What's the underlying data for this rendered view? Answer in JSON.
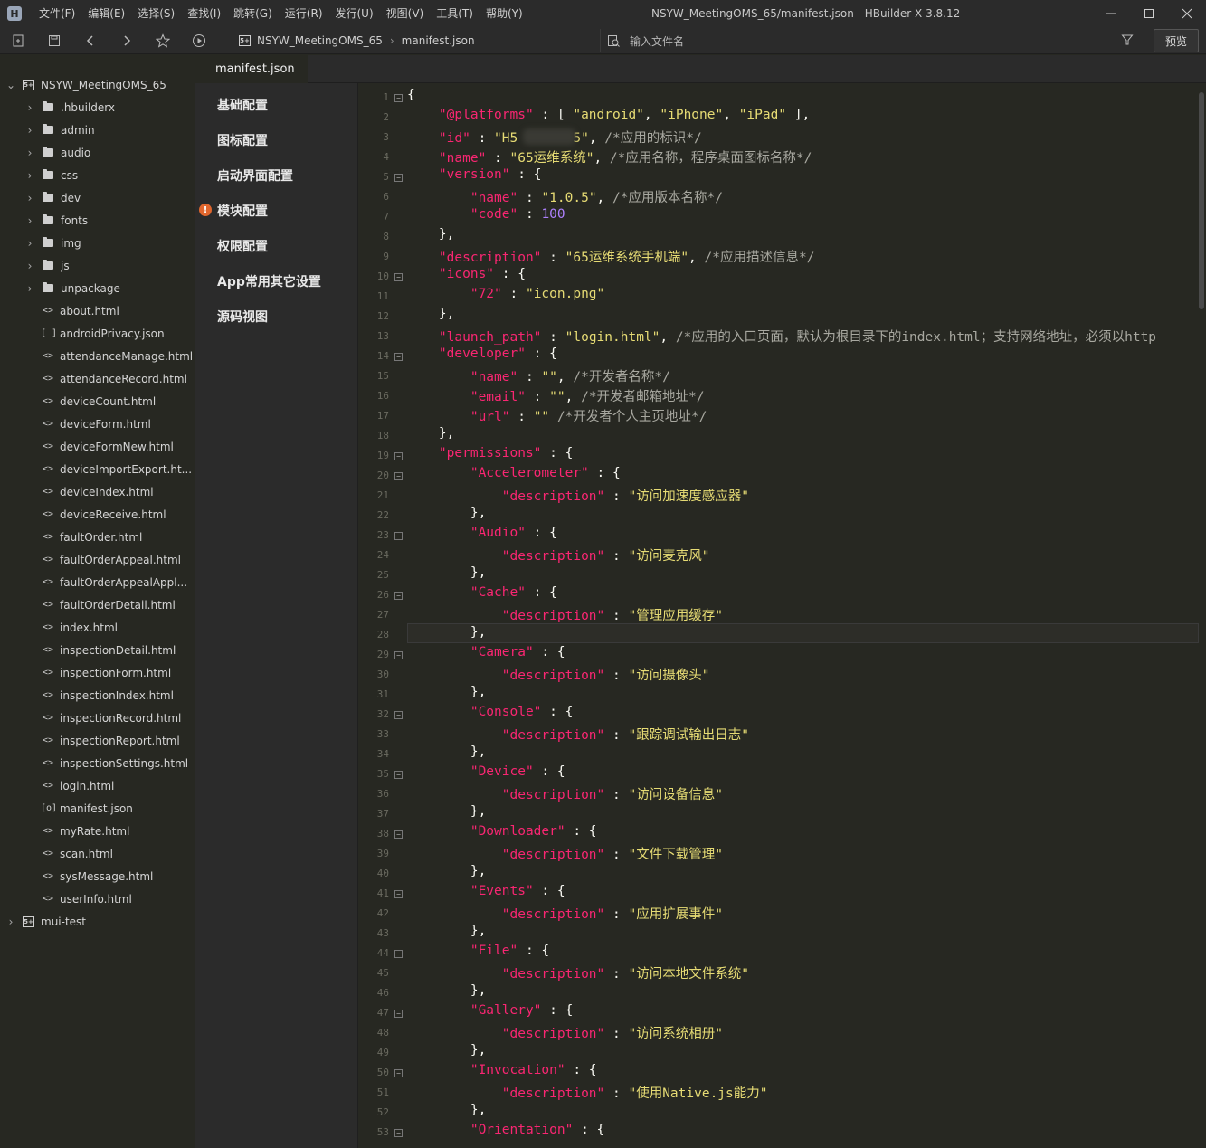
{
  "window": {
    "title": "NSYW_MeetingOMS_65/manifest.json - HBuilder X 3.8.12"
  },
  "menu": [
    "文件(F)",
    "编辑(E)",
    "选择(S)",
    "查找(I)",
    "跳转(G)",
    "运行(R)",
    "发行(U)",
    "视图(V)",
    "工具(T)",
    "帮助(Y)"
  ],
  "toolbar": {
    "breadcrumb": {
      "project": "NSYW_MeetingOMS_65",
      "file": "manifest.json"
    },
    "search_placeholder": "输入文件名",
    "preview_label": "预览"
  },
  "sidebar": {
    "project": "NSYW_MeetingOMS_65",
    "folders": [
      ".hbuilderx",
      "admin",
      "audio",
      "css",
      "dev",
      "fonts",
      "img",
      "js",
      "unpackage"
    ],
    "files": [
      {
        "icon": "<>",
        "name": "about.html"
      },
      {
        "icon": "[ ]",
        "name": "androidPrivacy.json"
      },
      {
        "icon": "<>",
        "name": "attendanceManage.html"
      },
      {
        "icon": "<>",
        "name": "attendanceRecord.html"
      },
      {
        "icon": "<>",
        "name": "deviceCount.html"
      },
      {
        "icon": "<>",
        "name": "deviceForm.html"
      },
      {
        "icon": "<>",
        "name": "deviceFormNew.html"
      },
      {
        "icon": "<>",
        "name": "deviceImportExport.ht..."
      },
      {
        "icon": "<>",
        "name": "deviceIndex.html"
      },
      {
        "icon": "<>",
        "name": "deviceReceive.html"
      },
      {
        "icon": "<>",
        "name": "faultOrder.html"
      },
      {
        "icon": "<>",
        "name": "faultOrderAppeal.html"
      },
      {
        "icon": "<>",
        "name": "faultOrderAppealAppl..."
      },
      {
        "icon": "<>",
        "name": "faultOrderDetail.html"
      },
      {
        "icon": "<>",
        "name": "index.html"
      },
      {
        "icon": "<>",
        "name": "inspectionDetail.html"
      },
      {
        "icon": "<>",
        "name": "inspectionForm.html"
      },
      {
        "icon": "<>",
        "name": "inspectionIndex.html"
      },
      {
        "icon": "<>",
        "name": "inspectionRecord.html"
      },
      {
        "icon": "<>",
        "name": "inspectionReport.html"
      },
      {
        "icon": "<>",
        "name": "inspectionSettings.html"
      },
      {
        "icon": "<>",
        "name": "login.html"
      },
      {
        "icon": "[o]",
        "name": "manifest.json"
      },
      {
        "icon": "<>",
        "name": "myRate.html"
      },
      {
        "icon": "<>",
        "name": "scan.html"
      },
      {
        "icon": "<>",
        "name": "sysMessage.html"
      },
      {
        "icon": "<>",
        "name": "userInfo.html"
      }
    ],
    "other_project": "mui-test"
  },
  "editor": {
    "tab": "manifest.json"
  },
  "config_nav": [
    "基础配置",
    "图标配置",
    "启动界面配置",
    "模块配置",
    "权限配置",
    "App常用其它设置",
    "源码视图"
  ],
  "code_lines": [
    [
      [
        "p",
        "{"
      ]
    ],
    [
      [
        "p",
        "    "
      ],
      [
        "k",
        "\"@platforms\""
      ],
      [
        "p",
        " : [ "
      ],
      [
        "s",
        "\"android\""
      ],
      [
        "p",
        ", "
      ],
      [
        "s",
        "\"iPhone\""
      ],
      [
        "p",
        ", "
      ],
      [
        "s",
        "\"iPad\""
      ],
      [
        "p",
        " ],"
      ]
    ],
    [
      [
        "p",
        "    "
      ],
      [
        "k",
        "\"id\""
      ],
      [
        "p",
        " : "
      ],
      [
        "s",
        "\"H5       5\""
      ],
      [
        "p",
        ", "
      ],
      [
        "c",
        "/*应用的标识*/"
      ]
    ],
    [
      [
        "p",
        "    "
      ],
      [
        "k",
        "\"name\""
      ],
      [
        "p",
        " : "
      ],
      [
        "s",
        "\"65运维系统\""
      ],
      [
        "p",
        ", "
      ],
      [
        "c",
        "/*应用名称，程序桌面图标名称*/"
      ]
    ],
    [
      [
        "p",
        "    "
      ],
      [
        "k",
        "\"version\""
      ],
      [
        "p",
        " : {"
      ]
    ],
    [
      [
        "p",
        "        "
      ],
      [
        "k",
        "\"name\""
      ],
      [
        "p",
        " : "
      ],
      [
        "s",
        "\"1.0.5\""
      ],
      [
        "p",
        ", "
      ],
      [
        "c",
        "/*应用版本名称*/"
      ]
    ],
    [
      [
        "p",
        "        "
      ],
      [
        "k",
        "\"code\""
      ],
      [
        "p",
        " : "
      ],
      [
        "n",
        "100"
      ]
    ],
    [
      [
        "p",
        "    },"
      ]
    ],
    [
      [
        "p",
        "    "
      ],
      [
        "k",
        "\"description\""
      ],
      [
        "p",
        " : "
      ],
      [
        "s",
        "\"65运维系统手机端\""
      ],
      [
        "p",
        ", "
      ],
      [
        "c",
        "/*应用描述信息*/"
      ]
    ],
    [
      [
        "p",
        "    "
      ],
      [
        "k",
        "\"icons\""
      ],
      [
        "p",
        " : {"
      ]
    ],
    [
      [
        "p",
        "        "
      ],
      [
        "k",
        "\"72\""
      ],
      [
        "p",
        " : "
      ],
      [
        "s",
        "\"icon.png\""
      ]
    ],
    [
      [
        "p",
        "    },"
      ]
    ],
    [
      [
        "p",
        "    "
      ],
      [
        "k",
        "\"launch_path\""
      ],
      [
        "p",
        " : "
      ],
      [
        "s",
        "\"login.html\""
      ],
      [
        "p",
        ", "
      ],
      [
        "c",
        "/*应用的入口页面，默认为根目录下的index.html；支持网络地址，必须以http"
      ]
    ],
    [
      [
        "p",
        "    "
      ],
      [
        "k",
        "\"developer\""
      ],
      [
        "p",
        " : {"
      ]
    ],
    [
      [
        "p",
        "        "
      ],
      [
        "k",
        "\"name\""
      ],
      [
        "p",
        " : "
      ],
      [
        "s",
        "\"\""
      ],
      [
        "p",
        ", "
      ],
      [
        "c",
        "/*开发者名称*/"
      ]
    ],
    [
      [
        "p",
        "        "
      ],
      [
        "k",
        "\"email\""
      ],
      [
        "p",
        " : "
      ],
      [
        "s",
        "\"\""
      ],
      [
        "p",
        ", "
      ],
      [
        "c",
        "/*开发者邮箱地址*/"
      ]
    ],
    [
      [
        "p",
        "        "
      ],
      [
        "k",
        "\"url\""
      ],
      [
        "p",
        " : "
      ],
      [
        "s",
        "\"\""
      ],
      [
        "p",
        " "
      ],
      [
        "c",
        "/*开发者个人主页地址*/"
      ]
    ],
    [
      [
        "p",
        "    },"
      ]
    ],
    [
      [
        "p",
        "    "
      ],
      [
        "k",
        "\"permissions\""
      ],
      [
        "p",
        " : {"
      ]
    ],
    [
      [
        "p",
        "        "
      ],
      [
        "k",
        "\"Accelerometer\""
      ],
      [
        "p",
        " : {"
      ]
    ],
    [
      [
        "p",
        "            "
      ],
      [
        "k",
        "\"description\""
      ],
      [
        "p",
        " : "
      ],
      [
        "s",
        "\"访问加速度感应器\""
      ]
    ],
    [
      [
        "p",
        "        },"
      ]
    ],
    [
      [
        "p",
        "        "
      ],
      [
        "k",
        "\"Audio\""
      ],
      [
        "p",
        " : {"
      ]
    ],
    [
      [
        "p",
        "            "
      ],
      [
        "k",
        "\"description\""
      ],
      [
        "p",
        " : "
      ],
      [
        "s",
        "\"访问麦克风\""
      ]
    ],
    [
      [
        "p",
        "        },"
      ]
    ],
    [
      [
        "p",
        "        "
      ],
      [
        "k",
        "\"Cache\""
      ],
      [
        "p",
        " : {"
      ]
    ],
    [
      [
        "p",
        "            "
      ],
      [
        "k",
        "\"description\""
      ],
      [
        "p",
        " : "
      ],
      [
        "s",
        "\"管理应用缓存\""
      ]
    ],
    [
      [
        "p",
        "        },"
      ]
    ],
    [
      [
        "p",
        "        "
      ],
      [
        "k",
        "\"Camera\""
      ],
      [
        "p",
        " : {"
      ]
    ],
    [
      [
        "p",
        "            "
      ],
      [
        "k",
        "\"description\""
      ],
      [
        "p",
        " : "
      ],
      [
        "s",
        "\"访问摄像头\""
      ]
    ],
    [
      [
        "p",
        "        },"
      ]
    ],
    [
      [
        "p",
        "        "
      ],
      [
        "k",
        "\"Console\""
      ],
      [
        "p",
        " : {"
      ]
    ],
    [
      [
        "p",
        "            "
      ],
      [
        "k",
        "\"description\""
      ],
      [
        "p",
        " : "
      ],
      [
        "s",
        "\"跟踪调试输出日志\""
      ]
    ],
    [
      [
        "p",
        "        },"
      ]
    ],
    [
      [
        "p",
        "        "
      ],
      [
        "k",
        "\"Device\""
      ],
      [
        "p",
        " : {"
      ]
    ],
    [
      [
        "p",
        "            "
      ],
      [
        "k",
        "\"description\""
      ],
      [
        "p",
        " : "
      ],
      [
        "s",
        "\"访问设备信息\""
      ]
    ],
    [
      [
        "p",
        "        },"
      ]
    ],
    [
      [
        "p",
        "        "
      ],
      [
        "k",
        "\"Downloader\""
      ],
      [
        "p",
        " : {"
      ]
    ],
    [
      [
        "p",
        "            "
      ],
      [
        "k",
        "\"description\""
      ],
      [
        "p",
        " : "
      ],
      [
        "s",
        "\"文件下载管理\""
      ]
    ],
    [
      [
        "p",
        "        },"
      ]
    ],
    [
      [
        "p",
        "        "
      ],
      [
        "k",
        "\"Events\""
      ],
      [
        "p",
        " : {"
      ]
    ],
    [
      [
        "p",
        "            "
      ],
      [
        "k",
        "\"description\""
      ],
      [
        "p",
        " : "
      ],
      [
        "s",
        "\"应用扩展事件\""
      ]
    ],
    [
      [
        "p",
        "        },"
      ]
    ],
    [
      [
        "p",
        "        "
      ],
      [
        "k",
        "\"File\""
      ],
      [
        "p",
        " : {"
      ]
    ],
    [
      [
        "p",
        "            "
      ],
      [
        "k",
        "\"description\""
      ],
      [
        "p",
        " : "
      ],
      [
        "s",
        "\"访问本地文件系统\""
      ]
    ],
    [
      [
        "p",
        "        },"
      ]
    ],
    [
      [
        "p",
        "        "
      ],
      [
        "k",
        "\"Gallery\""
      ],
      [
        "p",
        " : {"
      ]
    ],
    [
      [
        "p",
        "            "
      ],
      [
        "k",
        "\"description\""
      ],
      [
        "p",
        " : "
      ],
      [
        "s",
        "\"访问系统相册\""
      ]
    ],
    [
      [
        "p",
        "        },"
      ]
    ],
    [
      [
        "p",
        "        "
      ],
      [
        "k",
        "\"Invocation\""
      ],
      [
        "p",
        " : {"
      ]
    ],
    [
      [
        "p",
        "            "
      ],
      [
        "k",
        "\"description\""
      ],
      [
        "p",
        " : "
      ],
      [
        "s",
        "\"使用Native.js能力\""
      ]
    ],
    [
      [
        "p",
        "        },"
      ]
    ],
    [
      [
        "p",
        "        "
      ],
      [
        "k",
        "\"Orientation\""
      ],
      [
        "p",
        " : {"
      ]
    ]
  ],
  "fold_lines": [
    1,
    5,
    10,
    14,
    19,
    20,
    23,
    26,
    29,
    32,
    35,
    38,
    41,
    44,
    47,
    50,
    53
  ]
}
